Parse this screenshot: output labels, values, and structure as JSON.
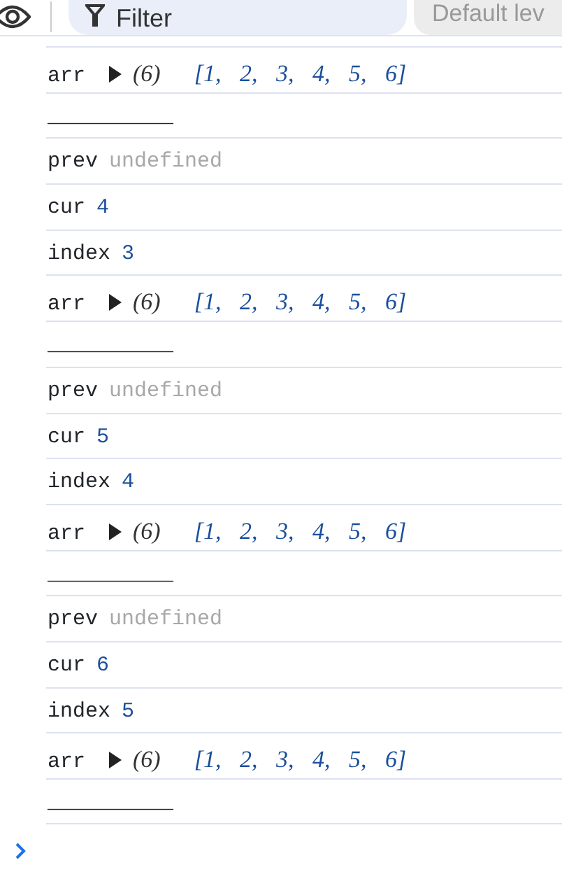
{
  "toolbar": {
    "filter": {
      "placeholder": "Filter"
    },
    "level_select": {
      "value": "Default lev"
    }
  },
  "logs": [
    {
      "kind": "array",
      "label": "arr",
      "expanded": false,
      "length": "(6)",
      "preview": "[1, 2, 3, 4, 5, 6]"
    },
    {
      "kind": "rule",
      "text": "__________"
    },
    {
      "kind": "pair",
      "label": "prev",
      "value": {
        "text": "undefined",
        "kind": "undefined"
      }
    },
    {
      "kind": "pair",
      "label": "cur",
      "value": {
        "text": "4",
        "kind": "number"
      }
    },
    {
      "kind": "pair",
      "label": "index",
      "value": {
        "text": "3",
        "kind": "number"
      }
    },
    {
      "kind": "array",
      "label": "arr",
      "expanded": false,
      "length": "(6)",
      "preview": "[1, 2, 3, 4, 5, 6]"
    },
    {
      "kind": "rule",
      "text": "__________"
    },
    {
      "kind": "pair",
      "label": "prev",
      "value": {
        "text": "undefined",
        "kind": "undefined"
      }
    },
    {
      "kind": "pair",
      "label": "cur",
      "value": {
        "text": "5",
        "kind": "number"
      }
    },
    {
      "kind": "pair",
      "label": "index",
      "value": {
        "text": "4",
        "kind": "number"
      }
    },
    {
      "kind": "array",
      "label": "arr",
      "expanded": false,
      "length": "(6)",
      "preview": "[1, 2, 3, 4, 5, 6]"
    },
    {
      "kind": "rule",
      "text": "__________"
    },
    {
      "kind": "pair",
      "label": "prev",
      "value": {
        "text": "undefined",
        "kind": "undefined"
      }
    },
    {
      "kind": "pair",
      "label": "cur",
      "value": {
        "text": "6",
        "kind": "number"
      }
    },
    {
      "kind": "pair",
      "label": "index",
      "value": {
        "text": "5",
        "kind": "number"
      }
    },
    {
      "kind": "array",
      "label": "arr",
      "expanded": false,
      "length": "(6)",
      "preview": "[1, 2, 3, 4, 5, 6]"
    },
    {
      "kind": "rule",
      "text": "__________"
    }
  ]
}
